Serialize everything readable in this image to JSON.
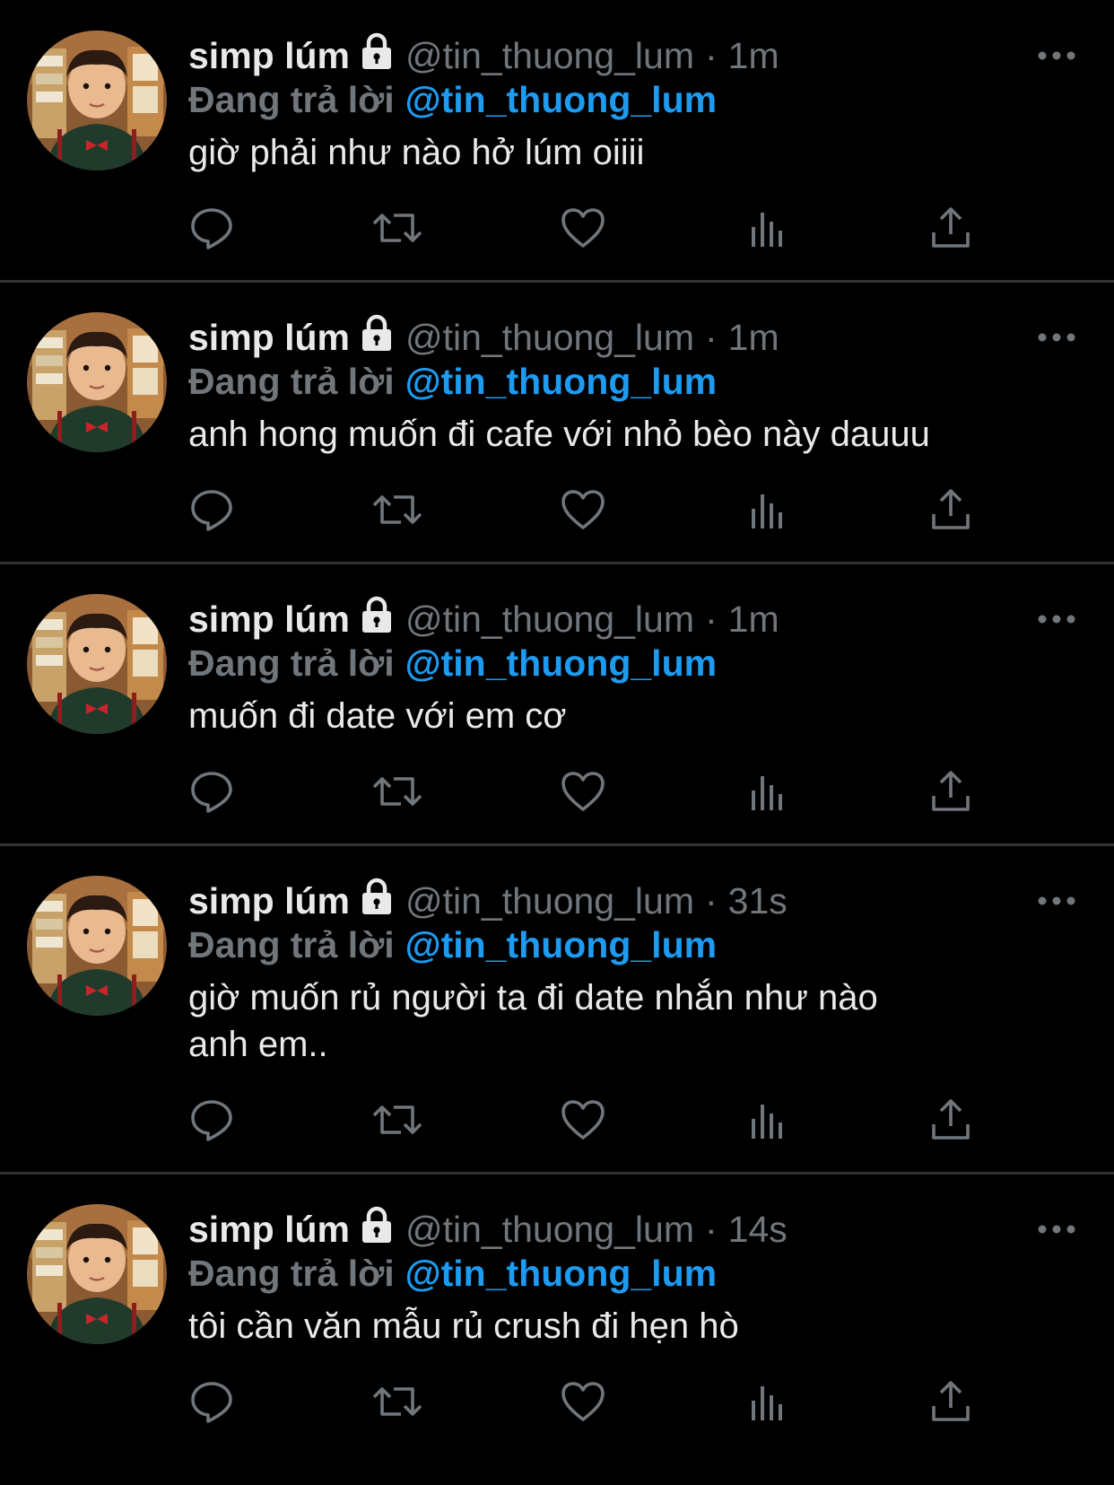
{
  "colors": {
    "background": "#000000",
    "divider": "#2f3336",
    "primary_text": "#e7e9ea",
    "secondary_text": "#71767b",
    "accent": "#1d9bf0"
  },
  "icons": {
    "protected": "lock-icon",
    "more": "more-icon",
    "reply": "reply-icon",
    "retweet": "retweet-icon",
    "like": "heart-icon",
    "views": "analytics-icon",
    "share": "share-icon"
  },
  "tweets": [
    {
      "display_name": "simp lúm",
      "handle": "@tin_thuong_lum",
      "separator": "·",
      "time": "1m",
      "reply_label": "Đang trả lời",
      "reply_to": "@tin_thuong_lum",
      "text": "giờ phải như nào hở lúm oiiii"
    },
    {
      "display_name": "simp lúm",
      "handle": "@tin_thuong_lum",
      "separator": "·",
      "time": "1m",
      "reply_label": "Đang trả lời",
      "reply_to": "@tin_thuong_lum",
      "text": "anh hong muốn đi cafe với nhỏ bèo này dauuu"
    },
    {
      "display_name": "simp lúm",
      "handle": "@tin_thuong_lum",
      "separator": "·",
      "time": "1m",
      "reply_label": "Đang trả lời",
      "reply_to": "@tin_thuong_lum",
      "text": "muốn đi date với em cơ"
    },
    {
      "display_name": "simp lúm",
      "handle": "@tin_thuong_lum",
      "separator": "·",
      "time": "31s",
      "reply_label": "Đang trả lời",
      "reply_to": "@tin_thuong_lum",
      "text": "giờ muốn rủ người ta đi date nhắn như nào\nanh em.."
    },
    {
      "display_name": "simp lúm",
      "handle": "@tin_thuong_lum",
      "separator": "·",
      "time": "14s",
      "reply_label": "Đang trả lời",
      "reply_to": "@tin_thuong_lum",
      "text": "tôi cần văn mẫu rủ crush đi hẹn hò"
    }
  ]
}
